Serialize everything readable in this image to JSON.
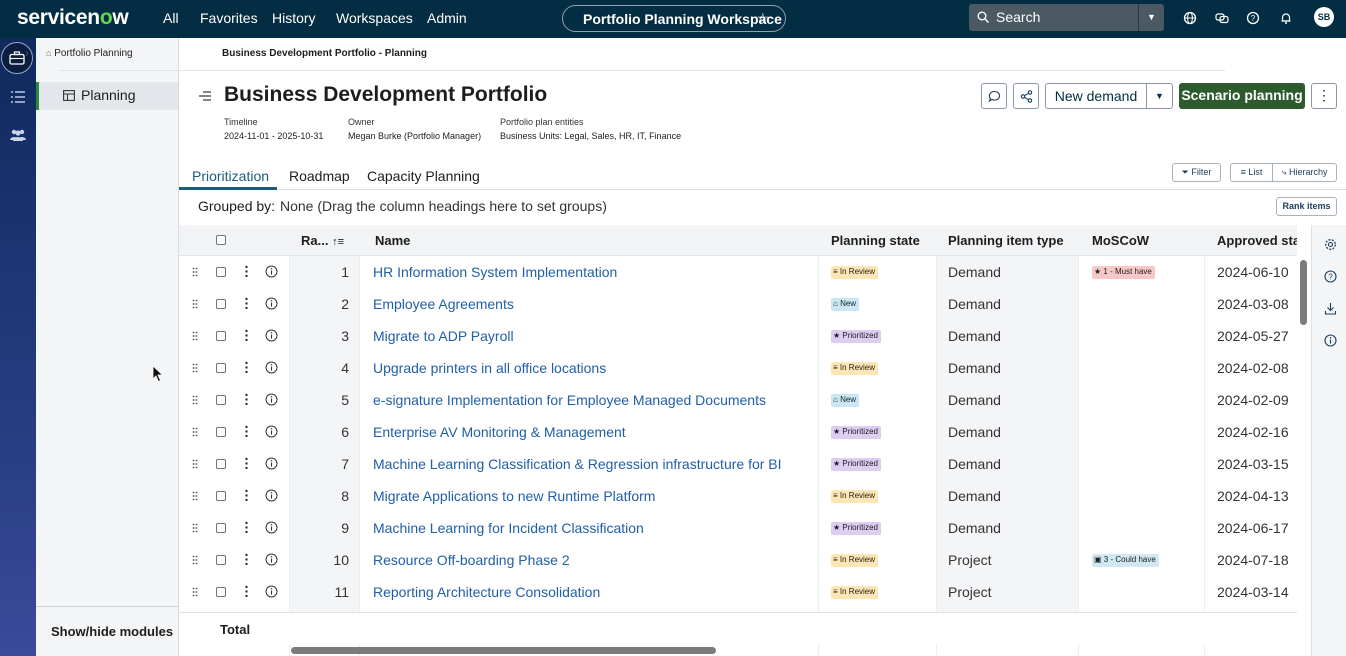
{
  "topbar": {
    "logo_a": "servicen",
    "logo_o": "o",
    "logo_b": "w",
    "nav": [
      "All",
      "Favorites",
      "History",
      "Workspaces",
      "Admin"
    ],
    "workspace": "Portfolio Planning Workspace",
    "search_placeholder": "Search",
    "avatar": "SB"
  },
  "breadcrumb": {
    "root": "Portfolio Planning",
    "current": "Business Development Portfolio - Planning"
  },
  "sidebar": {
    "active_module": "Planning",
    "show_hide": "Show/hide modules"
  },
  "header": {
    "title": "Business Development Portfolio",
    "timeline_label": "Timeline",
    "timeline_value": "2024-11-01 - 2025-10-31",
    "owner_label": "Owner",
    "owner_value": "Megan Burke (Portfolio Manager)",
    "entities_label": "Portfolio plan entities",
    "entities_value": "Business Units: Legal, Sales, HR, IT, Finance",
    "new_demand": "New demand",
    "scenario": "Scenario planning"
  },
  "tabs": [
    "Prioritization",
    "Roadmap",
    "Capacity Planning"
  ],
  "toolbar": {
    "filter": "Filter",
    "list": "List",
    "hierarchy": "Hierarchy",
    "rank_items": "Rank items",
    "grouped_label": "Grouped by:",
    "grouped_value": "None (Drag the column headings here to set groups)"
  },
  "grid": {
    "columns": [
      "Ra...",
      "Name",
      "Planning state",
      "Planning item type",
      "MoSCoW",
      "Approved star"
    ],
    "rows": [
      {
        "rank": "1",
        "name": "HR Information System Implementation",
        "state": "In Review",
        "state_kind": "review",
        "type": "Demand",
        "moscow": "1 - Must have",
        "moscow_kind": "must",
        "date": "2024-06-10"
      },
      {
        "rank": "2",
        "name": "Employee Agreements",
        "state": "New",
        "state_kind": "new",
        "type": "Demand",
        "moscow": "",
        "moscow_kind": "",
        "date": "2024-03-08"
      },
      {
        "rank": "3",
        "name": "Migrate to ADP Payroll",
        "state": "Prioritized",
        "state_kind": "prior",
        "type": "Demand",
        "moscow": "",
        "moscow_kind": "",
        "date": "2024-05-27"
      },
      {
        "rank": "4",
        "name": "Upgrade printers in all office locations",
        "state": "In Review",
        "state_kind": "review",
        "type": "Demand",
        "moscow": "",
        "moscow_kind": "",
        "date": "2024-02-08"
      },
      {
        "rank": "5",
        "name": "e-signature Implementation for Employee Managed Documents",
        "state": "New",
        "state_kind": "new",
        "type": "Demand",
        "moscow": "",
        "moscow_kind": "",
        "date": "2024-02-09"
      },
      {
        "rank": "6",
        "name": "Enterprise AV Monitoring & Management",
        "state": "Prioritized",
        "state_kind": "prior",
        "type": "Demand",
        "moscow": "",
        "moscow_kind": "",
        "date": "2024-02-16"
      },
      {
        "rank": "7",
        "name": "Machine Learning Classification & Regression infrastructure for BI",
        "state": "Prioritized",
        "state_kind": "prior",
        "type": "Demand",
        "moscow": "",
        "moscow_kind": "",
        "date": "2024-03-15"
      },
      {
        "rank": "8",
        "name": "Migrate Applications to new Runtime Platform",
        "state": "In Review",
        "state_kind": "review",
        "type": "Demand",
        "moscow": "",
        "moscow_kind": "",
        "date": "2024-04-13"
      },
      {
        "rank": "9",
        "name": "Machine Learning for Incident Classification",
        "state": "Prioritized",
        "state_kind": "prior",
        "type": "Demand",
        "moscow": "",
        "moscow_kind": "",
        "date": "2024-06-17"
      },
      {
        "rank": "10",
        "name": "Resource Off-boarding Phase 2",
        "state": "In Review",
        "state_kind": "review",
        "type": "Project",
        "moscow": "3 - Could have",
        "moscow_kind": "could",
        "date": "2024-07-18"
      },
      {
        "rank": "11",
        "name": "Reporting Architecture Consolidation",
        "state": "In Review",
        "state_kind": "review",
        "type": "Project",
        "moscow": "",
        "moscow_kind": "",
        "date": "2024-03-14"
      }
    ],
    "total_label": "Total"
  }
}
